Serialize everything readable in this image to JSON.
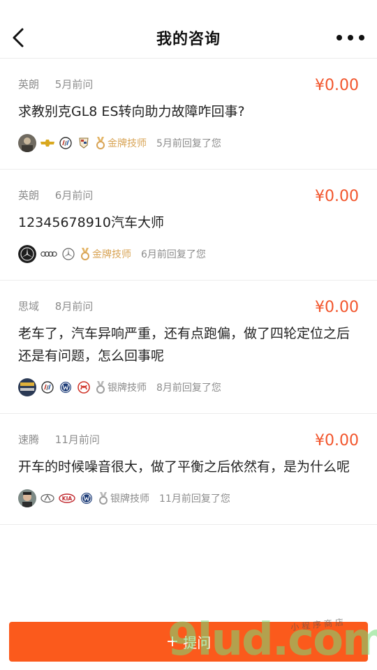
{
  "header": {
    "title": "我的咨询"
  },
  "consultations": [
    {
      "model": "英朗",
      "time": "5月前问",
      "price": "¥0.00",
      "question": "求教别克GL8 ES转向助力故障咋回事?",
      "rank_label": "金牌技师",
      "rank_level": "gold",
      "reply": "5月前回复了您"
    },
    {
      "model": "英朗",
      "time": "6月前问",
      "price": "¥0.00",
      "question": "12345678910汽车大师",
      "rank_label": "金牌技师",
      "rank_level": "gold",
      "reply": "6月前回复了您"
    },
    {
      "model": "思域",
      "time": "8月前问",
      "price": "¥0.00",
      "question": "老车了，汽车异响严重，还有点跑偏，做了四轮定位之后还是有问题，怎么回事呢",
      "rank_label": "银牌技师",
      "rank_level": "silver",
      "reply": "8月前回复了您"
    },
    {
      "model": "速腾",
      "time": "11月前问",
      "price": "¥0.00",
      "question": "开车的时候噪音很大，做了平衡之后依然有，是为什么呢",
      "rank_label": "银牌技师",
      "rank_level": "silver",
      "reply": "11月前回复了您"
    }
  ],
  "ask_button": {
    "icon": "+",
    "label": "提问"
  },
  "watermark": {
    "big": "9lud.com",
    "small": "小程序商店"
  },
  "colors": {
    "accent": "#fb5a1c",
    "price": "#f2552c",
    "gold": "#d8a354",
    "silver": "#8a8a8a"
  }
}
